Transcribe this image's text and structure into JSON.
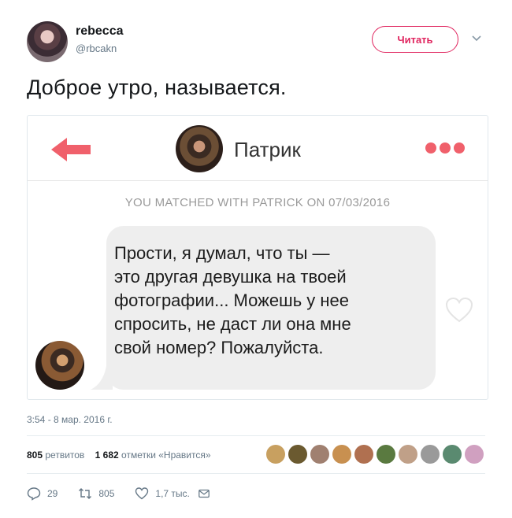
{
  "author": {
    "name": "rebecca",
    "handle": "@rbcakn"
  },
  "follow_label": "Читать",
  "tweet_text": "Доброе утро, называется.",
  "card": {
    "match_name": "Патрик",
    "matched_text": "YOU MATCHED WITH PATRICK ON 07/03/2016",
    "message_lines": [
      "Прости, я думал, что ты —",
      "это другая девушка на твоей",
      "фотографии... Можешь у нее",
      "спросить, не даст ли она мне",
      "свой номер? Пожалуйста."
    ],
    "accent_color": "#f0606b"
  },
  "timestamp": "3:54 - 8 мар. 2016 г.",
  "stats": {
    "retweets_count": "805",
    "retweets_label": "ретвитов",
    "likes_count": "1 682",
    "likes_label": "отметки «Нравится»"
  },
  "likers_colors": [
    "#c8a060",
    "#6b5a30",
    "#a08070",
    "#c89050",
    "#b07050",
    "#5a7a40",
    "#c0a088",
    "#9a9a9a",
    "#5a8a70",
    "#d0a0c0"
  ],
  "actions": {
    "replies": "29",
    "retweets": "805",
    "likes": "1,7 тыс."
  },
  "icons": {
    "reply": "reply-icon",
    "retweet": "retweet-icon",
    "like": "heart-icon",
    "dm": "envelope-icon",
    "caret": "chevron-down-icon"
  }
}
